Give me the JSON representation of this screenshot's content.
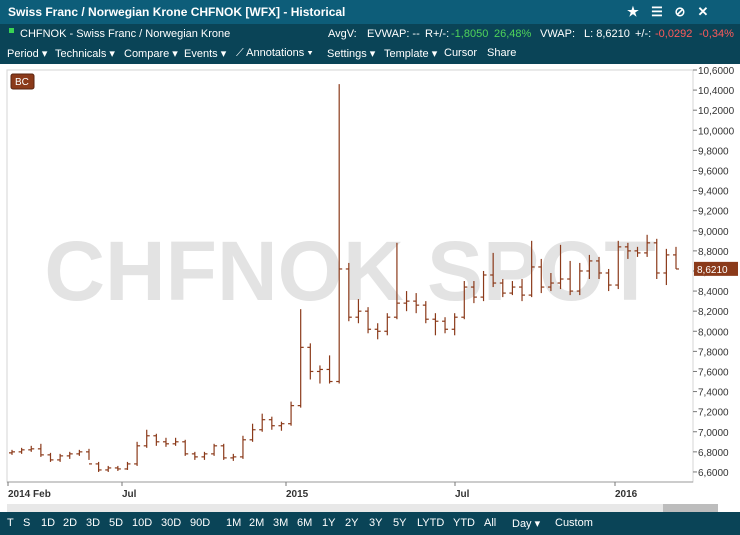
{
  "window": {
    "title": "Swiss Franc / Norwegian Krone CHFNOK [WFX] - Historical",
    "icons": [
      "star-icon",
      "menu-icon",
      "unlink-icon",
      "close-icon"
    ]
  },
  "info": {
    "name": "CHFNOK - Swiss Franc / Norwegian Krone",
    "avgv": "AvgV:",
    "evwap": "EVWAP: --",
    "rchange_label": "R+/-:",
    "rchange": "-1,8050",
    "rpct": "26,48%",
    "vwap": "VWAP:",
    "last": "L: 8,6210",
    "chg_label": "+/-:",
    "chg": "-0,0292",
    "chg_pct": "-0,34%"
  },
  "menu": [
    "Period",
    "Technicals",
    "Compare",
    "Events",
    "Annotations",
    "Settings",
    "Template",
    "Cursor",
    "Share"
  ],
  "chart": {
    "badge": "BC",
    "watermark": "CHFNOK SPOT",
    "last_label": "8,6210",
    "accent": "#8b3a1a",
    "y_ticks": [
      "10,6000",
      "10,4000",
      "10,2000",
      "10,0000",
      "9,8000",
      "9,6000",
      "9,4000",
      "9,2000",
      "9,0000",
      "8,8000",
      "8,6000",
      "8,4000",
      "8,2000",
      "8,0000",
      "7,8000",
      "7,6000",
      "7,4000",
      "7,2000",
      "7,0000",
      "6,8000",
      "6,6000"
    ],
    "x_ticks": [
      "2014 Feb",
      "Jul",
      "2015",
      "Jul",
      "2016"
    ]
  },
  "chart_data": {
    "type": "ohlc",
    "ylim": [
      6.5,
      10.6
    ],
    "ohlc": [
      [
        6.79,
        6.82,
        6.77,
        6.8
      ],
      [
        6.8,
        6.84,
        6.78,
        6.82
      ],
      [
        6.82,
        6.86,
        6.8,
        6.83
      ],
      [
        6.83,
        6.88,
        6.75,
        6.77
      ],
      [
        6.77,
        6.79,
        6.7,
        6.72
      ],
      [
        6.72,
        6.78,
        6.7,
        6.76
      ],
      [
        6.76,
        6.8,
        6.73,
        6.78
      ],
      [
        6.78,
        6.82,
        6.76,
        6.8
      ],
      [
        6.8,
        6.83,
        6.72,
        6.68
      ],
      [
        6.68,
        6.7,
        6.6,
        6.62
      ],
      [
        6.62,
        6.66,
        6.6,
        6.64
      ],
      [
        6.64,
        6.66,
        6.61,
        6.63
      ],
      [
        6.63,
        6.7,
        6.62,
        6.68
      ],
      [
        6.68,
        6.9,
        6.66,
        6.86
      ],
      [
        6.86,
        7.02,
        6.84,
        6.96
      ],
      [
        6.96,
        6.98,
        6.86,
        6.9
      ],
      [
        6.9,
        6.94,
        6.85,
        6.88
      ],
      [
        6.88,
        6.94,
        6.86,
        6.9
      ],
      [
        6.9,
        6.92,
        6.76,
        6.78
      ],
      [
        6.78,
        6.8,
        6.72,
        6.75
      ],
      [
        6.75,
        6.8,
        6.72,
        6.78
      ],
      [
        6.78,
        6.88,
        6.76,
        6.86
      ],
      [
        6.86,
        6.88,
        6.72,
        6.74
      ],
      [
        6.74,
        6.78,
        6.71,
        6.75
      ],
      [
        6.75,
        6.96,
        6.73,
        6.92
      ],
      [
        6.92,
        7.08,
        6.9,
        7.02
      ],
      [
        7.02,
        7.18,
        7.0,
        7.12
      ],
      [
        7.12,
        7.15,
        7.02,
        7.06
      ],
      [
        7.06,
        7.1,
        7.01,
        7.08
      ],
      [
        7.08,
        7.3,
        7.06,
        7.26
      ],
      [
        7.26,
        8.22,
        7.24,
        7.84
      ],
      [
        7.84,
        7.88,
        7.52,
        7.6
      ],
      [
        7.6,
        7.66,
        7.48,
        7.62
      ],
      [
        7.62,
        7.76,
        7.48,
        7.5
      ],
      [
        7.5,
        10.46,
        7.48,
        8.62
      ],
      [
        8.62,
        8.68,
        8.1,
        8.14
      ],
      [
        8.14,
        8.32,
        8.08,
        8.2
      ],
      [
        8.2,
        8.24,
        7.98,
        8.02
      ],
      [
        8.02,
        8.08,
        7.92,
        8.0
      ],
      [
        8.0,
        8.18,
        7.96,
        8.14
      ],
      [
        8.14,
        8.88,
        8.12,
        8.28
      ],
      [
        8.28,
        8.4,
        8.2,
        8.3
      ],
      [
        8.3,
        8.38,
        8.18,
        8.26
      ],
      [
        8.26,
        8.3,
        8.08,
        8.12
      ],
      [
        8.12,
        8.18,
        7.96,
        8.1
      ],
      [
        8.1,
        8.14,
        7.98,
        8.02
      ],
      [
        8.02,
        8.18,
        7.96,
        8.14
      ],
      [
        8.14,
        8.5,
        8.12,
        8.44
      ],
      [
        8.44,
        8.5,
        8.28,
        8.34
      ],
      [
        8.34,
        8.6,
        8.3,
        8.56
      ],
      [
        8.56,
        8.78,
        8.44,
        8.48
      ],
      [
        8.48,
        8.52,
        8.34,
        8.38
      ],
      [
        8.38,
        8.5,
        8.36,
        8.44
      ],
      [
        8.44,
        8.52,
        8.3,
        8.36
      ],
      [
        8.36,
        8.9,
        8.34,
        8.64
      ],
      [
        8.64,
        8.72,
        8.38,
        8.44
      ],
      [
        8.44,
        8.58,
        8.4,
        8.48
      ],
      [
        8.48,
        8.86,
        8.42,
        8.52
      ],
      [
        8.52,
        8.7,
        8.36,
        8.4
      ],
      [
        8.4,
        8.68,
        8.36,
        8.6
      ],
      [
        8.6,
        8.76,
        8.52,
        8.7
      ],
      [
        8.7,
        8.74,
        8.52,
        8.58
      ],
      [
        8.58,
        8.62,
        8.4,
        8.46
      ],
      [
        8.46,
        8.9,
        8.42,
        8.84
      ],
      [
        8.84,
        8.88,
        8.72,
        8.8
      ],
      [
        8.8,
        8.84,
        8.74,
        8.78
      ],
      [
        8.78,
        8.96,
        8.74,
        8.88
      ],
      [
        8.88,
        8.92,
        8.52,
        8.58
      ],
      [
        8.58,
        8.82,
        8.46,
        8.76
      ],
      [
        8.76,
        8.84,
        8.62,
        8.62
      ]
    ]
  },
  "bottom": [
    "T",
    "S",
    "1D",
    "2D",
    "3D",
    "5D",
    "10D",
    "30D",
    "90D",
    "1M",
    "2M",
    "3M",
    "6M",
    "1Y",
    "2Y",
    "3Y",
    "5Y",
    "LYTD",
    "YTD",
    "All",
    "Day",
    "Custom"
  ]
}
